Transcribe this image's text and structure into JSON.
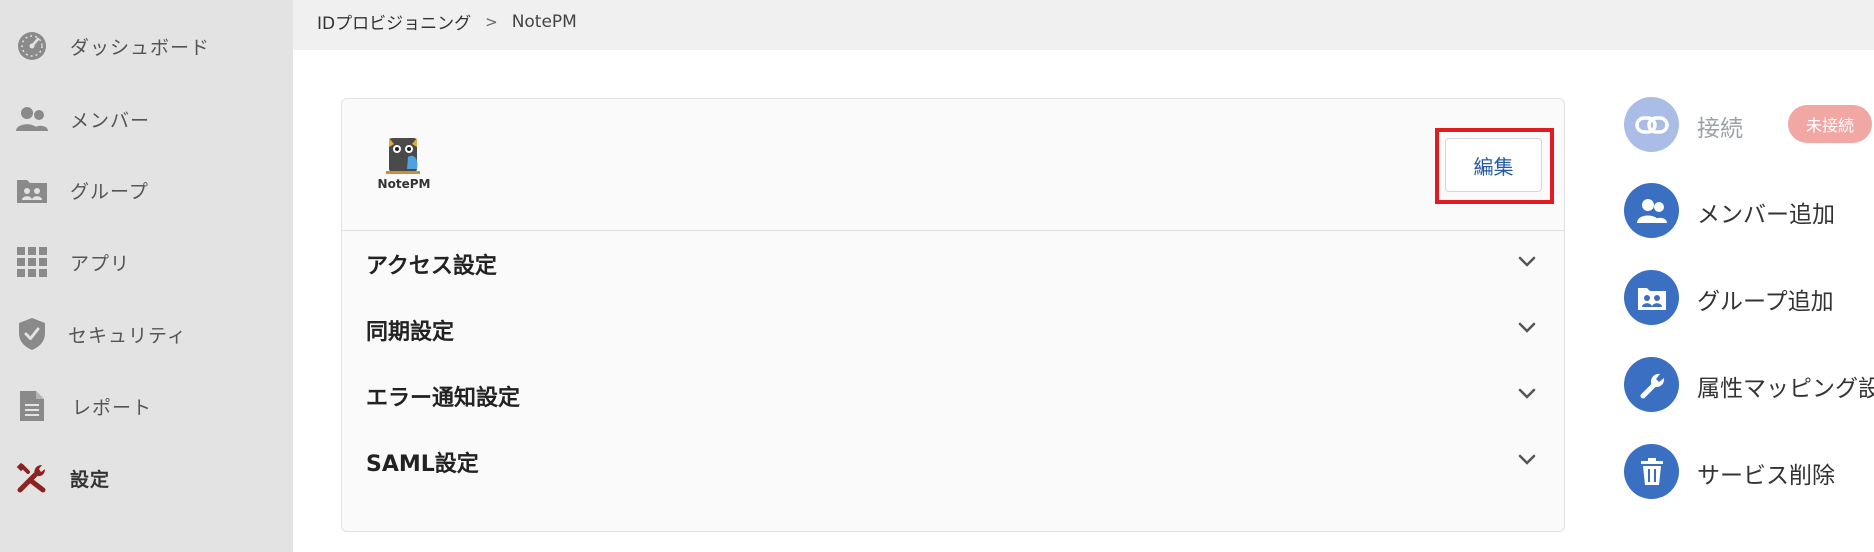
{
  "sidebar": {
    "items": [
      {
        "label": "ダッシュボード",
        "icon": "speedometer-icon"
      },
      {
        "label": "メンバー",
        "icon": "users-icon"
      },
      {
        "label": "グループ",
        "icon": "group-folder-icon"
      },
      {
        "label": "アプリ",
        "icon": "apps-grid-icon"
      },
      {
        "label": "セキュリティ",
        "icon": "shield-check-icon"
      },
      {
        "label": "レポート",
        "icon": "document-icon"
      },
      {
        "label": "設定",
        "icon": "tools-icon",
        "active": true
      }
    ]
  },
  "breadcrumb": {
    "parent": "IDプロビジョニング",
    "separator": ">",
    "current": "NotePM"
  },
  "card": {
    "edit_label": "編集",
    "logo_text": "NotePM",
    "sections": [
      {
        "title": "アクセス設定"
      },
      {
        "title": "同期設定"
      },
      {
        "title": "エラー通知設定"
      },
      {
        "title": "SAML設定"
      }
    ]
  },
  "actions": {
    "connect": {
      "label": "接続",
      "badge": "未接続"
    },
    "add_member": {
      "label": "メンバー追加"
    },
    "add_group": {
      "label": "グループ追加"
    },
    "attribute_mapping": {
      "label": "属性マッピング設"
    },
    "delete_service": {
      "label": "サービス削除"
    }
  },
  "colors": {
    "sidebar_bg": "#e3e3e3",
    "accent_blue": "#3a6fc2",
    "highlight_red": "#e11b22",
    "badge_pink": "#f1a7a4",
    "active_icon": "#8b2323"
  }
}
